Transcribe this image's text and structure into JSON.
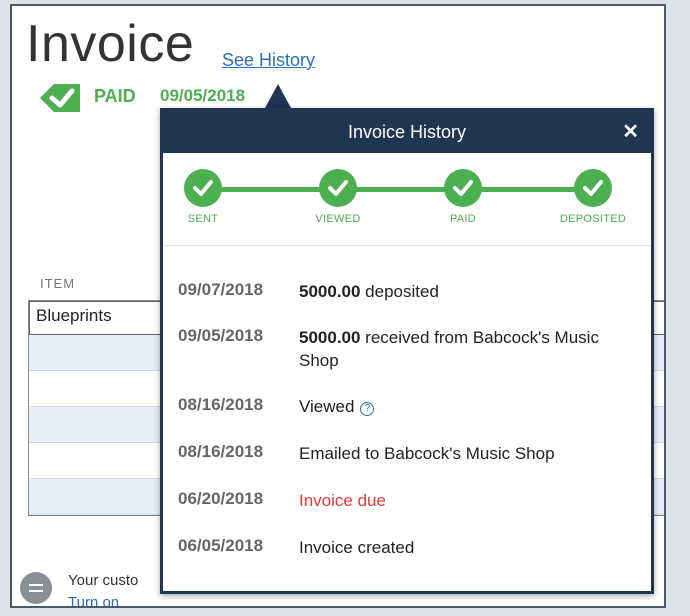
{
  "invoice": {
    "title": "Invoice",
    "see_history": "See History",
    "status": "PAID",
    "status_date": "09/05/2018",
    "item_header": "ITEM",
    "first_item": "Blueprints",
    "footer_text": "Your custo",
    "footer_link": "Turn on"
  },
  "popover": {
    "title": "Invoice History",
    "close": "✕",
    "steps": [
      "SENT",
      "VIEWED",
      "PAID",
      "DEPOSITED"
    ],
    "history": [
      {
        "date": "09/07/2018",
        "amount": "5000.00",
        "text": " deposited"
      },
      {
        "date": "09/05/2018",
        "amount": "5000.00",
        "text": " received from Babcock's Music Shop"
      },
      {
        "date": "08/16/2018",
        "amount": "",
        "text": "Viewed"
      },
      {
        "date": "08/16/2018",
        "amount": "",
        "text": "Emailed to Babcock's Music Shop"
      },
      {
        "date": "06/20/2018",
        "amount": "",
        "text": "Invoice due"
      },
      {
        "date": "06/05/2018",
        "amount": "",
        "text": "Invoice created"
      }
    ]
  },
  "colors": {
    "accent_green": "#4caf50",
    "header_navy": "#1f3552",
    "link_blue": "#2b6fb6",
    "due_red": "#e53935"
  }
}
